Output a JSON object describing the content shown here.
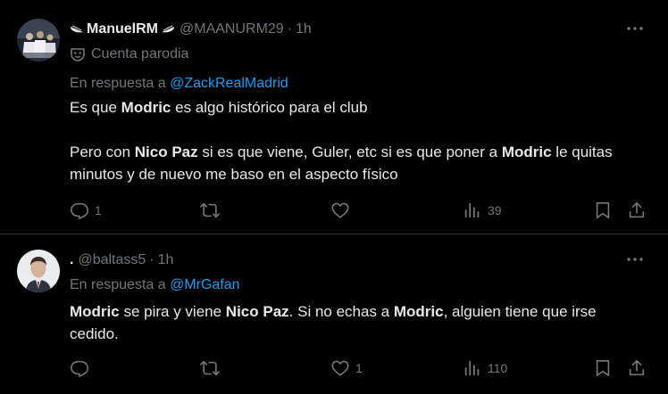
{
  "tweets": [
    {
      "display_name": "ManuelRM",
      "handle": "@MAANURM29",
      "separator": "·",
      "time": "1h",
      "parody_label": "Cuenta parodia",
      "reply_prefix": "En respuesta a",
      "reply_to": "@ZackRealMadrid",
      "text": {
        "p1_a": "Es que ",
        "p1_b": "Modric",
        "p1_c": " es algo histórico para el club",
        "p2_a": "Pero con ",
        "p2_b": "Nico Paz",
        "p2_c": " si es que viene, Guler, etc si es que poner a ",
        "p2_d": "Modric",
        "p2_e": " le quitas minutos y de nuevo me baso en el aspecto físico"
      },
      "stats": {
        "replies": "1",
        "retweets": "",
        "likes": "",
        "views": "39"
      }
    },
    {
      "display_name": ".",
      "handle": "@baltass5",
      "separator": "·",
      "time": "1h",
      "reply_prefix": "En respuesta a",
      "reply_to": "@MrGafan",
      "text": {
        "a": "Modric",
        "b": " se pira y viene ",
        "c": "Nico Paz",
        "d": ". Si no echas a ",
        "e": "Modric",
        "f": ", alguien tiene que irse cedido."
      },
      "stats": {
        "replies": "",
        "retweets": "",
        "likes": "1",
        "views": "110"
      }
    }
  ],
  "icons": {
    "reply": "reply-icon",
    "retweet": "retweet-icon",
    "like": "heart-icon",
    "views": "views-icon",
    "bookmark": "bookmark-icon",
    "share": "share-icon",
    "more": "more-icon",
    "parody": "parody-mask-icon"
  },
  "colors": {
    "background": "#000000",
    "text": "#e7e9ea",
    "muted": "#71767b",
    "link": "#1d9bf0",
    "divider": "#2f3336"
  }
}
